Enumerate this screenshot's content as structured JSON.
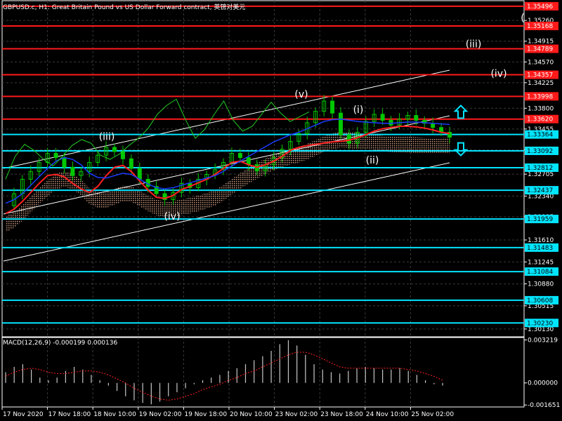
{
  "header": {
    "title": "GBPUSD.c, H1:  Great Britain Pound vs US Dollar Forward contract, 英镑对美元"
  },
  "colors": {
    "background": "#000000",
    "grid": "#3a3a3a",
    "axis": "#ffffff",
    "candles": "#00c800",
    "red_level": "#ff1a1a",
    "cyan_level": "#00e5ff",
    "channel": "#ffffff",
    "tenkan": "#ff2020",
    "kijun": "#1a3cff",
    "chikou": "#22cc22",
    "cloud": "#d9a58a",
    "macd_hist": "#c8c8c8",
    "macd_signal": "#ff2020"
  },
  "chart_data": [
    {
      "type": "line",
      "name": "price-panel",
      "x_tick_labels": [
        "17 Nov 2020",
        "17 Nov 18:00",
        "18 Nov 10:00",
        "19 Nov 02:00",
        "19 Nov 18:00",
        "20 Nov 10:00",
        "23 Nov 02:00",
        "23 Nov 18:00",
        "24 Nov 10:00",
        "25 Nov 02:00"
      ],
      "y_tick_labels": [
        "1.35260",
        "1.34915",
        "1.34570",
        "1.34225",
        "1.33800",
        "1.33455",
        "1.33110",
        "1.32705",
        "1.32340",
        "1.31995",
        "1.31610",
        "1.31245",
        "1.30880",
        "1.30515",
        "1.30130"
      ],
      "ylim": [
        1.3,
        1.356
      ],
      "price_levels_red": [
        "1.35496",
        "1.35168",
        "1.34789",
        "1.34357",
        "1.33998",
        "1.33620"
      ],
      "price_levels_cyan": [
        "1.33364",
        "1.33092",
        "1.32812",
        "1.32437",
        "1.31959",
        "1.31483",
        "1.31084",
        "1.30608",
        "1.30230"
      ],
      "wave_labels": [
        {
          "text": "(iii)",
          "x": "18 Nov 10:00",
          "y": 1.3327
        },
        {
          "text": "(iv)",
          "x": "19 Nov 02:00",
          "y": 1.3195
        },
        {
          "text": "(v)",
          "x": "23 Nov 02:00",
          "y": 1.3398
        },
        {
          "text": "(i)",
          "x": "23 Nov 18:00",
          "y": 1.3372
        },
        {
          "text": "(ii)",
          "x": "24 Nov 10:00",
          "y": 1.3288
        },
        {
          "text": "(iii)",
          "x": "future",
          "y": 1.3481
        },
        {
          "text": "(iv)",
          "x": "future",
          "y": 1.3432
        },
        {
          "text": "(",
          "x": "future",
          "y": 1.3525
        }
      ],
      "arrows": [
        {
          "direction": "up",
          "y": 1.3374
        },
        {
          "direction": "down",
          "y": 1.3312
        }
      ],
      "series": [
        {
          "name": "",
          "kind": "close",
          "values": [
            1.3218,
            1.3238,
            1.3262,
            1.3275,
            1.329,
            1.3305,
            1.3298,
            1.3282,
            1.3268,
            1.3275,
            1.329,
            1.3302,
            1.3315,
            1.3308,
            1.3296,
            1.328,
            1.3262,
            1.325,
            1.3238,
            1.3228,
            1.324,
            1.3255,
            1.3248,
            1.3262,
            1.327,
            1.3278,
            1.329,
            1.3305,
            1.3298,
            1.3286,
            1.3276,
            1.3286,
            1.3298,
            1.3312,
            1.3325,
            1.3338,
            1.3356,
            1.3375,
            1.3392,
            1.3372,
            1.3336,
            1.3322,
            1.334,
            1.3358,
            1.337,
            1.336,
            1.3352,
            1.3362,
            1.3368,
            1.336,
            1.3355,
            1.3348,
            1.334,
            1.3332
          ]
        },
        {
          "name": "",
          "kind": "tenkan",
          "values": [
            1.3205,
            1.3212,
            1.3225,
            1.324,
            1.3255,
            1.3268,
            1.327,
            1.3266,
            1.3255,
            1.3246,
            1.324,
            1.325,
            1.3268,
            1.3282,
            1.3285,
            1.3275,
            1.3259,
            1.3244,
            1.3232,
            1.323,
            1.3235,
            1.3245,
            1.325,
            1.3256,
            1.3262,
            1.327,
            1.328,
            1.329,
            1.3292,
            1.3286,
            1.3282,
            1.3286,
            1.3292,
            1.33,
            1.331,
            1.3315,
            1.3318,
            1.332,
            1.3322,
            1.3324,
            1.3325,
            1.3327,
            1.3331,
            1.3336,
            1.3342,
            1.3346,
            1.3348,
            1.335,
            1.335,
            1.3349,
            1.3347,
            1.3344,
            1.334,
            1.3338
          ]
        },
        {
          "name": "",
          "kind": "kijun",
          "values": [
            1.3222,
            1.3228,
            1.3238,
            1.3252,
            1.3266,
            1.328,
            1.3292,
            1.3298,
            1.3295,
            1.3286,
            1.3272,
            1.3265,
            1.3264,
            1.3268,
            1.3272,
            1.327,
            1.3262,
            1.3254,
            1.3248,
            1.3246,
            1.3248,
            1.3252,
            1.3256,
            1.326,
            1.3264,
            1.3268,
            1.3275,
            1.3284,
            1.3292,
            1.33,
            1.3308,
            1.3316,
            1.3324,
            1.333,
            1.3336,
            1.334,
            1.3346,
            1.3352,
            1.3358,
            1.3361,
            1.3362,
            1.336,
            1.3358,
            1.3357,
            1.3356,
            1.3355,
            1.3355,
            1.3356,
            1.3357,
            1.3357,
            1.3356,
            1.3355,
            1.3354,
            1.3353
          ]
        },
        {
          "name": "",
          "kind": "chikou",
          "values": [
            1.3262,
            1.33,
            1.332,
            1.331,
            1.3295,
            1.3284,
            1.33,
            1.3318,
            1.3328,
            1.3322,
            1.3302,
            1.3295,
            1.3304,
            1.3318,
            1.333,
            1.3346,
            1.337,
            1.3385,
            1.3395,
            1.336,
            1.333,
            1.3345,
            1.337,
            1.3392,
            1.336,
            1.3342,
            1.335,
            1.337,
            1.339,
            1.3372,
            1.3358,
            1.3366,
            1.3374
          ]
        }
      ]
    },
    {
      "type": "bar",
      "name": "macd-panel",
      "title": "MACD(12,26,9) -0.000199 0.000136",
      "y_tick_labels": [
        "0.003219",
        "0.000000",
        "-0.001651"
      ],
      "ylim": [
        -0.0018,
        0.0034
      ],
      "series": [
        {
          "name": "",
          "kind": "histogram",
          "values": [
            0.0008,
            0.0012,
            0.0014,
            0.001,
            0.0004,
            0.0002,
            0.0004,
            0.0009,
            0.0012,
            0.001,
            0.0006,
            0.0002,
            -0.0002,
            -0.0006,
            -0.001,
            -0.0013,
            -0.0015,
            -0.0016,
            -0.0014,
            -0.001,
            -0.0007,
            -0.0004,
            -0.0001,
            0.0002,
            0.0004,
            0.0006,
            0.0009,
            0.0011,
            0.0014,
            0.0017,
            0.002,
            0.0024,
            0.0029,
            0.0032,
            0.0028,
            0.0021,
            0.0014,
            0.001,
            0.0008,
            0.0007,
            0.0009,
            0.0011,
            0.0012,
            0.0011,
            0.001,
            0.001,
            0.0011,
            0.0009,
            0.0006,
            0.0002,
            -0.0001,
            -0.0002
          ]
        },
        {
          "name": "",
          "kind": "signal",
          "values": [
            0.0005,
            0.0008,
            0.001,
            0.0011,
            0.001,
            0.0008,
            0.0007,
            0.0007,
            0.0008,
            0.0009,
            0.0009,
            0.0008,
            0.0006,
            0.0003,
            0.0,
            -0.0004,
            -0.0007,
            -0.001,
            -0.0012,
            -0.0013,
            -0.0012,
            -0.001,
            -0.0008,
            -0.0005,
            -0.0003,
            -0.0001,
            0.0002,
            0.0004,
            0.0007,
            0.0009,
            0.0012,
            0.0015,
            0.0018,
            0.0021,
            0.0023,
            0.0023,
            0.0021,
            0.0018,
            0.0015,
            0.0012,
            0.0011,
            0.0011,
            0.0011,
            0.0011,
            0.0011,
            0.0011,
            0.0011,
            0.001,
            0.0009,
            0.0007,
            0.0005,
            0.0002
          ]
        }
      ]
    }
  ]
}
